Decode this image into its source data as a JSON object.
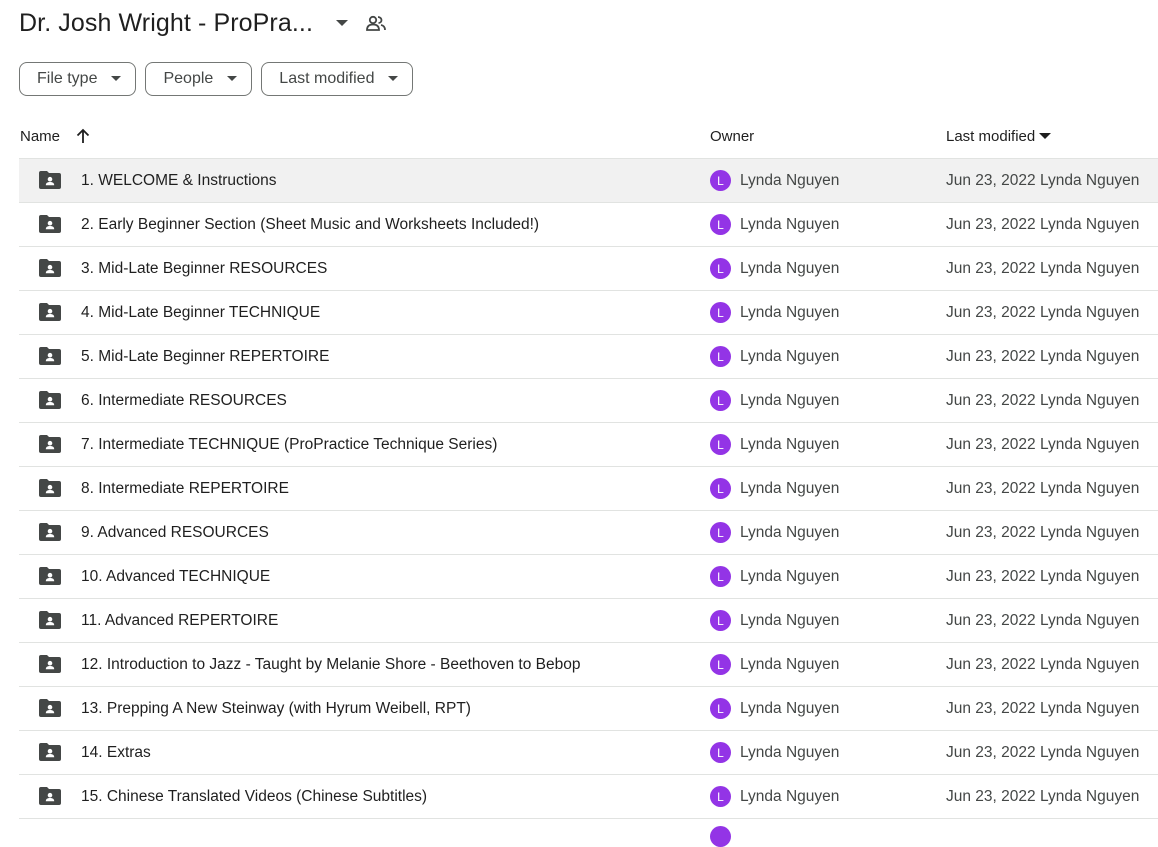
{
  "header": {
    "title": "Dr. Josh Wright - ProPra...",
    "title_dropdown_icon": "arrow-drop-down-icon",
    "shared_icon": "people-icon"
  },
  "filters": [
    {
      "label": "File type",
      "icon": "arrow-drop-down-icon"
    },
    {
      "label": "People",
      "icon": "arrow-drop-down-icon"
    },
    {
      "label": "Last modified",
      "icon": "arrow-drop-down-icon"
    }
  ],
  "table": {
    "columns": {
      "name": "Name",
      "owner": "Owner",
      "modified": "Last modified"
    },
    "sort_icon": "arrow-upward-icon",
    "rows": [
      {
        "name": "1. WELCOME & Instructions",
        "owner_initial": "L",
        "owner": "Lynda Nguyen",
        "modified": "Jun 23, 2022 Lynda Nguyen"
      },
      {
        "name": "2. Early Beginner Section (Sheet Music and Worksheets Included!)",
        "owner_initial": "L",
        "owner": "Lynda Nguyen",
        "modified": "Jun 23, 2022 Lynda Nguyen"
      },
      {
        "name": "3. Mid-Late Beginner RESOURCES",
        "owner_initial": "L",
        "owner": "Lynda Nguyen",
        "modified": "Jun 23, 2022 Lynda Nguyen"
      },
      {
        "name": "4. Mid-Late Beginner TECHNIQUE",
        "owner_initial": "L",
        "owner": "Lynda Nguyen",
        "modified": "Jun 23, 2022 Lynda Nguyen"
      },
      {
        "name": "5. Mid-Late Beginner REPERTOIRE",
        "owner_initial": "L",
        "owner": "Lynda Nguyen",
        "modified": "Jun 23, 2022 Lynda Nguyen"
      },
      {
        "name": "6. Intermediate RESOURCES",
        "owner_initial": "L",
        "owner": "Lynda Nguyen",
        "modified": "Jun 23, 2022 Lynda Nguyen"
      },
      {
        "name": "7. Intermediate TECHNIQUE (ProPractice Technique Series)",
        "owner_initial": "L",
        "owner": "Lynda Nguyen",
        "modified": "Jun 23, 2022 Lynda Nguyen"
      },
      {
        "name": "8. Intermediate REPERTOIRE",
        "owner_initial": "L",
        "owner": "Lynda Nguyen",
        "modified": "Jun 23, 2022 Lynda Nguyen"
      },
      {
        "name": "9. Advanced RESOURCES",
        "owner_initial": "L",
        "owner": "Lynda Nguyen",
        "modified": "Jun 23, 2022 Lynda Nguyen"
      },
      {
        "name": "10. Advanced TECHNIQUE",
        "owner_initial": "L",
        "owner": "Lynda Nguyen",
        "modified": "Jun 23, 2022 Lynda Nguyen"
      },
      {
        "name": "11. Advanced REPERTOIRE",
        "owner_initial": "L",
        "owner": "Lynda Nguyen",
        "modified": "Jun 23, 2022 Lynda Nguyen"
      },
      {
        "name": "12. Introduction to Jazz - Taught by Melanie Shore - Beethoven to Bebop",
        "owner_initial": "L",
        "owner": "Lynda Nguyen",
        "modified": "Jun 23, 2022 Lynda Nguyen"
      },
      {
        "name": "13. Prepping A New Steinway (with Hyrum Weibell, RPT)",
        "owner_initial": "L",
        "owner": "Lynda Nguyen",
        "modified": "Jun 23, 2022 Lynda Nguyen"
      },
      {
        "name": "14. Extras",
        "owner_initial": "L",
        "owner": "Lynda Nguyen",
        "modified": "Jun 23, 2022 Lynda Nguyen"
      },
      {
        "name": "15. Chinese Translated Videos (Chinese Subtitles)",
        "owner_initial": "L",
        "owner": "Lynda Nguyen",
        "modified": "Jun 23, 2022 Lynda Nguyen"
      }
    ]
  },
  "colors": {
    "avatar": "#9334e6",
    "selected_row": "#f1f1f1",
    "divider": "#e1e3e1"
  }
}
